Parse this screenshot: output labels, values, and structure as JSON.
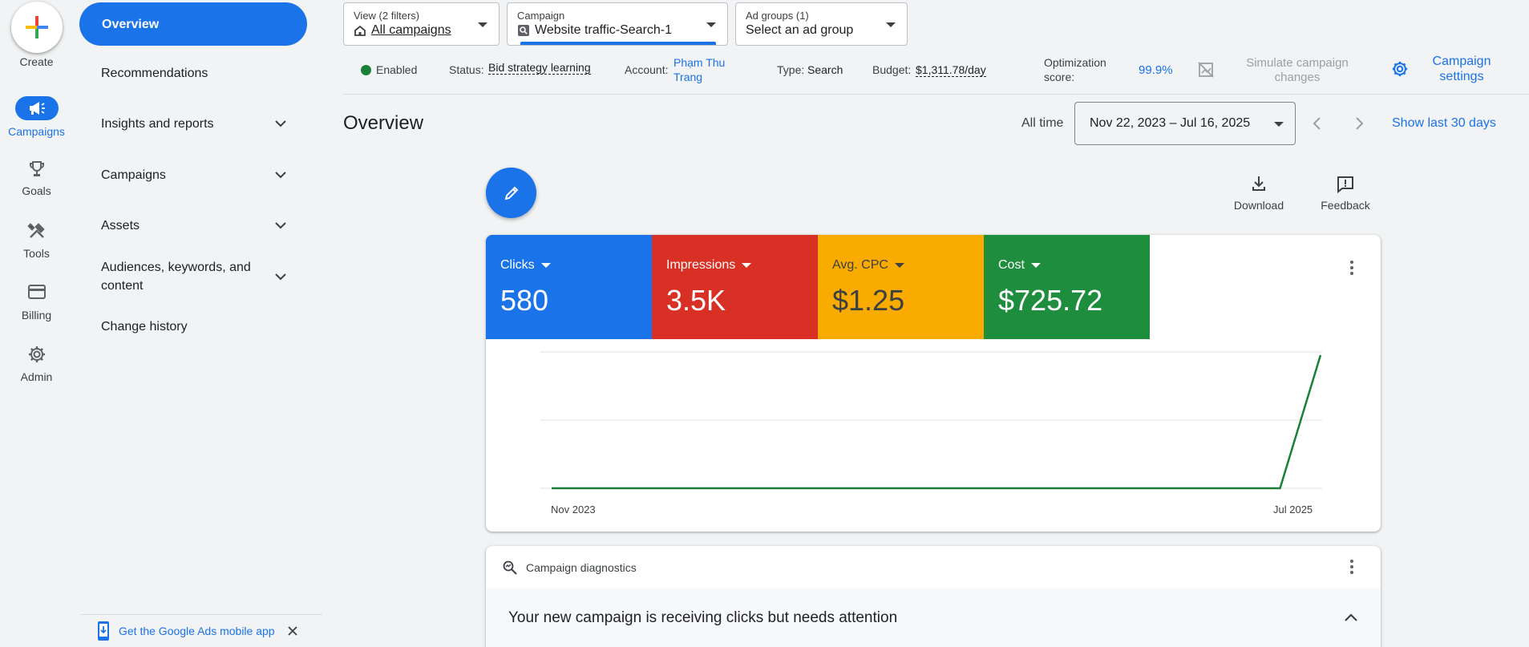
{
  "rail": {
    "create_label": "Create",
    "items": [
      {
        "label": "Campaigns",
        "icon": "megaphone-icon",
        "active": true
      },
      {
        "label": "Goals",
        "icon": "trophy-icon"
      },
      {
        "label": "Tools",
        "icon": "tools-icon"
      },
      {
        "label": "Billing",
        "icon": "credit-card-icon"
      },
      {
        "label": "Admin",
        "icon": "gear-icon"
      }
    ]
  },
  "sidenav": {
    "items": [
      {
        "label": "Overview",
        "active": true
      },
      {
        "label": "Recommendations"
      },
      {
        "label": "Insights and reports",
        "expandable": true
      },
      {
        "label": "Campaigns",
        "expandable": true
      },
      {
        "label": "Assets",
        "expandable": true
      },
      {
        "label": "Audiences, keywords, and content",
        "expandable": true
      },
      {
        "label": "Change history"
      }
    ],
    "mobile_app_label": "Get the Google Ads mobile app"
  },
  "filters": {
    "view": {
      "small": "View (2 filters)",
      "value": "All campaigns"
    },
    "campaign": {
      "small": "Campaign",
      "value": "Website traffic-Search-1"
    },
    "adgroups": {
      "small": "Ad groups (1)",
      "value": "Select an ad group"
    }
  },
  "status": {
    "enabled": "Enabled",
    "status_label": "Status:",
    "status_value": "Bid strategy learning",
    "account_label": "Account:",
    "account_value_line1": "Phạm Thu",
    "account_value_line2": "Trang",
    "type_label": "Type:",
    "type_value": "Search",
    "budget_label": "Budget:",
    "budget_value": "$1,311.78/day",
    "opt_label_line1": "Optimization",
    "opt_label_line2": "score:",
    "opt_value": "99.9%",
    "simulate_line1": "Simulate campaign",
    "simulate_line2": "changes",
    "settings_line1": "Campaign",
    "settings_line2": "settings"
  },
  "page": {
    "title": "Overview",
    "all_time": "All time",
    "date_range": "Nov 22, 2023 – Jul 16, 2025",
    "show_last": "Show last 30 days"
  },
  "tools": {
    "download": "Download",
    "feedback": "Feedback"
  },
  "metrics": [
    {
      "name": "Clicks",
      "value": "580",
      "color": "#1a73e8"
    },
    {
      "name": "Impressions",
      "value": "3.5K",
      "color": "#d93025"
    },
    {
      "name": "Avg. CPC",
      "value": "$1.25",
      "color": "#f9ab00"
    },
    {
      "name": "Cost",
      "value": "$725.72",
      "color": "#1e8e3e"
    }
  ],
  "chart_data": {
    "type": "line",
    "x_tick_labels": [
      "Nov 2023",
      "Jul 2025"
    ],
    "series": [
      {
        "color": "#188038",
        "values": [
          0,
          0,
          0,
          0,
          0,
          0,
          0,
          0,
          0,
          0,
          0,
          0,
          0,
          0,
          0,
          0,
          0,
          0,
          0,
          1
        ]
      }
    ],
    "ylim": [
      0,
      1
    ],
    "grid": true
  },
  "diagnostics": {
    "title": "Campaign diagnostics",
    "message": "Your new campaign is receiving clicks but needs attention"
  }
}
